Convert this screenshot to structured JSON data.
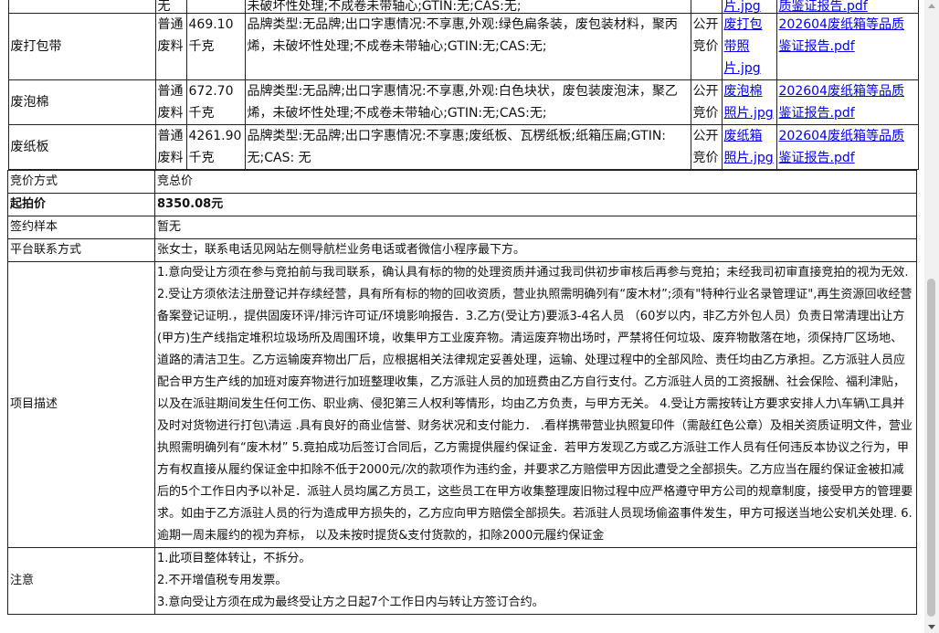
{
  "top_partial": {
    "text": "未破坏性处理;不成卷未带轴心;GTIN:无;CAS:无;",
    "cat": "无",
    "photo": "片.jpg",
    "report": "质鉴证报告.pdf"
  },
  "items": [
    {
      "name": "废打包带",
      "category": "普通废料",
      "qty": "469.10 千克",
      "desc": "品牌类型:无品牌;出口字惠情况:不享惠,外观:绿色扁条装，废包装材料，聚丙烯，未破坏性处理;不成卷未带轴心;GTIN:无;CAS:无;",
      "method": "公开竞价",
      "photo": "废打包带照片.jpg",
      "report": "202604废纸箱等品质鉴证报告.pdf"
    },
    {
      "name": "废泡棉",
      "category": "普通废料",
      "qty": "672.70 千克",
      "desc": "品牌类型:无品牌;出口字惠情况:不享惠,外观:白色块状，废包装废泡沫，聚乙烯，未破坏性处理;不成卷未带轴心;GTIN:无;CAS:无;",
      "method": "公开竞价",
      "photo": "废泡棉照片.jpg",
      "report": "202604废纸箱等品质鉴证报告.pdf"
    },
    {
      "name": "废纸板",
      "category": "普通废料",
      "qty": "4261.90千克",
      "desc": "品牌类型:无品牌;出口字惠情况:不享惠;废纸板、瓦楞纸板;纸箱压扁;GTIN:无;CAS: 无",
      "method": "公开竞价",
      "photo": "废纸箱照片.jpg",
      "report": "202604废纸箱等品质鉴证报告.pdf"
    }
  ],
  "rows": {
    "bid_method": {
      "label": "竞价方式",
      "value": "竞总价"
    },
    "start_price": {
      "label": "起拍价",
      "value": "8350.08元"
    },
    "contract": {
      "label": "签约样本",
      "value": "暂无"
    },
    "contact": {
      "label": "平台联系方式",
      "value": "张女士，联系电话见网站左侧导航栏业务电话或者微信小程序最下方。"
    },
    "description": {
      "label": "项目描述",
      "value": "1.意向受让方须在参与竞拍前与我司联系，确认具有标的物的处理资质并通过我司供初步审核后再参与竞拍；未经我司初审直接竞拍的视为无效. 2.受让方须依法注册登记并存续经营，具有所有标的物的回收资质，营业执照需明确列有“废木材”;须有\"特种行业名录管理证\",再生资源回收经营备案登记证明.，提供固废环评/排污许可证/环境影响报告．3.乙方(受让方)要派3-4名人员 （60岁以内，非乙方外包人员）负责日常清理出让方(甲方)生产线指定堆积垃圾场所及周围环境，收集甲方工业废弃物。清运废弃物出场时，严禁将任何垃圾、废弃物散落在地，须保持厂区场地、道路的清洁卫生。乙方运输废弃物出厂后，应根据相关法律规定妥善处理，运输、处理过程中的全部风险、责任均由乙方承担。乙方派驻人员应配合甲方生产线的加班对废弃物进行加班整理收集，乙方派驻人员的加班费由乙方自行支付。乙方派驻人员的工资报酬、社会保险、福利津贴，以及在派驻期间发生任何工伤、职业病、侵犯第三人权利等情形，均由乙方负责，与甲方无关。 4.受让方需按转让方要求安排人力\\车辆\\工具并及时对货物进行打包\\清运 .具有良好的商业信誉、财务状况和支付能力． .看样携带营业执照复印件（需敲红色公章）及相关资质证明文件，营业执照需明确列有“废木材” 5.竟拍成功后签订合同后，乙方需提供履约保证金．若甲方发现乙方或乙方派驻工作人员有任何违反本协议之行为，甲方有权直接从履约保证金中扣除不低于2000元/次的款项作为违约金，并要求乙方赔偿甲方因此遭受之全部损失。乙方应当在履约保证金被扣减后的5个工作日内予以补足．派驻人员均属乙方员工，这些员工在甲方收集整理废旧物过程中应严格遵守甲方公司的规章制度，接受甲方的管理要求。如由于乙方派驻人员的行为造成甲方损失的，乙方应向甲方赔偿全部损失。若派驻人员现场偷盗事件发生，甲方可报送当地公安机关处理. 6.逾期一周未履约的视为弃标， 以及未按时提货&支付货款的，扣除2000元履约保证金"
    },
    "notes": {
      "label": "注意",
      "lines": [
        "1.此项目整体转让，不拆分。",
        "2.不开增值税专用发票。",
        "3.意向受让方须在成为最终受让方之日起7个工作日内与转让方签订合约。"
      ]
    }
  },
  "colors": {
    "link": "#0000ee",
    "border": "#222222",
    "scroll_thumb": "#c1c1c1"
  }
}
